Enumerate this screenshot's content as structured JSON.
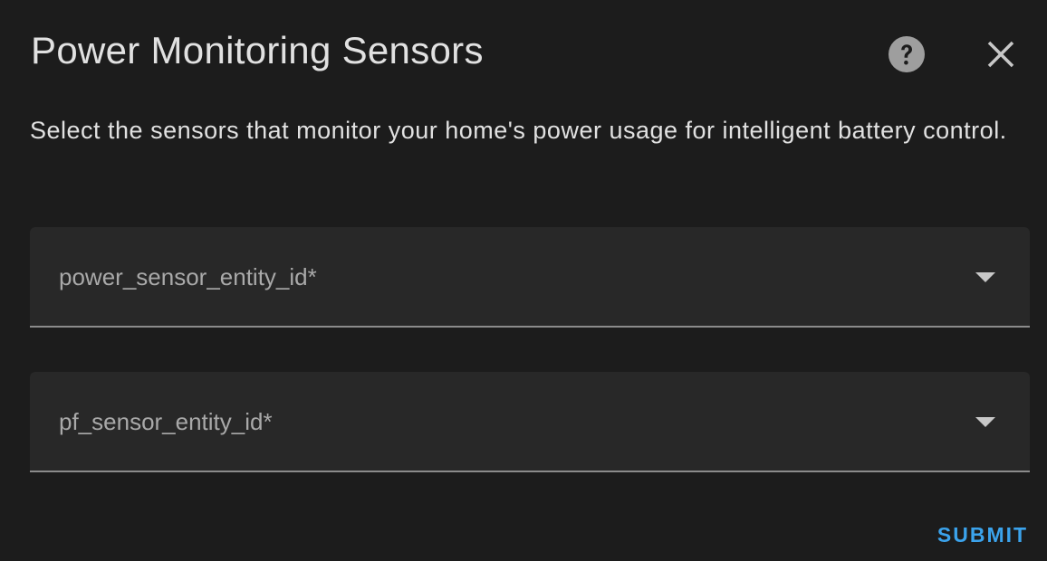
{
  "dialog": {
    "title": "Power Monitoring Sensors",
    "description": "Select the sensors that monitor your home's power usage for intelligent battery control.",
    "help_icon": "help-circle-icon",
    "close_icon": "close-icon"
  },
  "fields": [
    {
      "label": "power_sensor_entity_id*",
      "value": "",
      "icon": "chevron-down-icon"
    },
    {
      "label": "pf_sensor_entity_id*",
      "value": "",
      "icon": "chevron-down-icon"
    }
  ],
  "actions": {
    "submit_label": "SUBMIT"
  },
  "colors": {
    "background": "#1c1c1c",
    "field_background": "#282828",
    "text": "#e1e1e1",
    "muted_text": "#a9a9a9",
    "accent": "#3ba3ec"
  }
}
